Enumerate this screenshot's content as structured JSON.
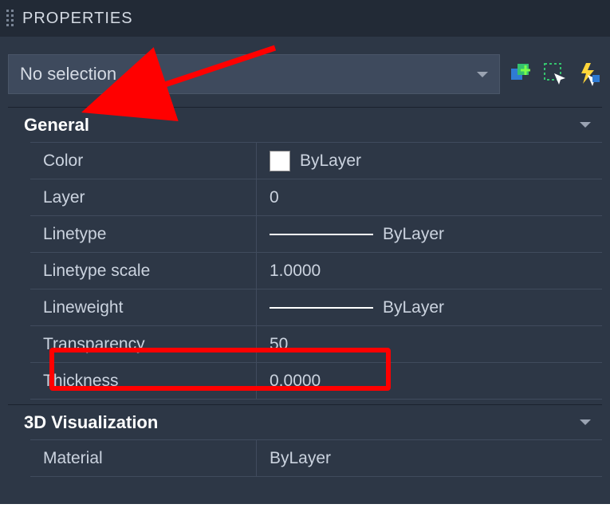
{
  "header": {
    "title": "PROPERTIES"
  },
  "selection": {
    "value": "No selection"
  },
  "icons": {
    "quick_select": "quick-select-icon",
    "picker_set": "picker-set-icon",
    "lightning": "lightning-icon"
  },
  "sections": {
    "general": {
      "title": "General",
      "rows": {
        "color": {
          "label": "Color",
          "value": "ByLayer"
        },
        "layer": {
          "label": "Layer",
          "value": "0"
        },
        "linetype": {
          "label": "Linetype",
          "value": "ByLayer"
        },
        "linetypescale": {
          "label": "Linetype scale",
          "value": "1.0000"
        },
        "lineweight": {
          "label": "Lineweight",
          "value": "ByLayer"
        },
        "transparency": {
          "label": "Transparency",
          "value": "50"
        },
        "thickness": {
          "label": "Thickness",
          "value": "0.0000"
        }
      }
    },
    "viz3d": {
      "title": "3D Visualization",
      "rows": {
        "material": {
          "label": "Material",
          "value": "ByLayer"
        }
      }
    }
  }
}
